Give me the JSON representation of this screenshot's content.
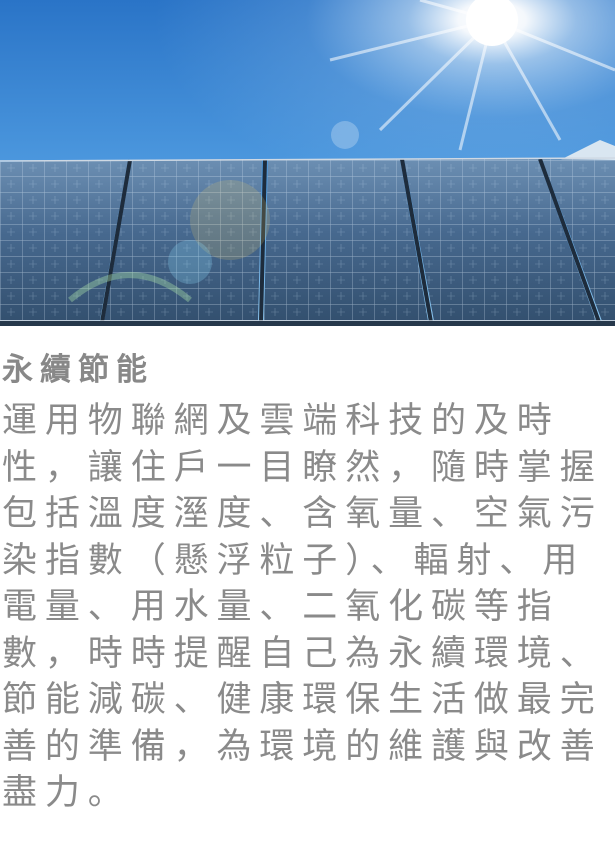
{
  "section": {
    "title": "永續節能",
    "paragraph": "運用物聯網及雲端科技的及時性，讓住戶一目瞭然，隨時掌握包括溫度溼度、含氧量、空氣污染指數（懸浮粒子）、輻射、用電量、用水量、二氧化碳等指數，時時提醒自己為永續環境、節能減碳、健康環保生活做最完善的準備，為環境的維護與改善盡力。"
  },
  "hero": {
    "icon": "solar-panel-photo",
    "sky_color": "#2f7fd0",
    "panel_color": "#3a5f86"
  },
  "colors": {
    "text": "#8a8a8a",
    "heading": "#888888",
    "background": "#ffffff"
  }
}
